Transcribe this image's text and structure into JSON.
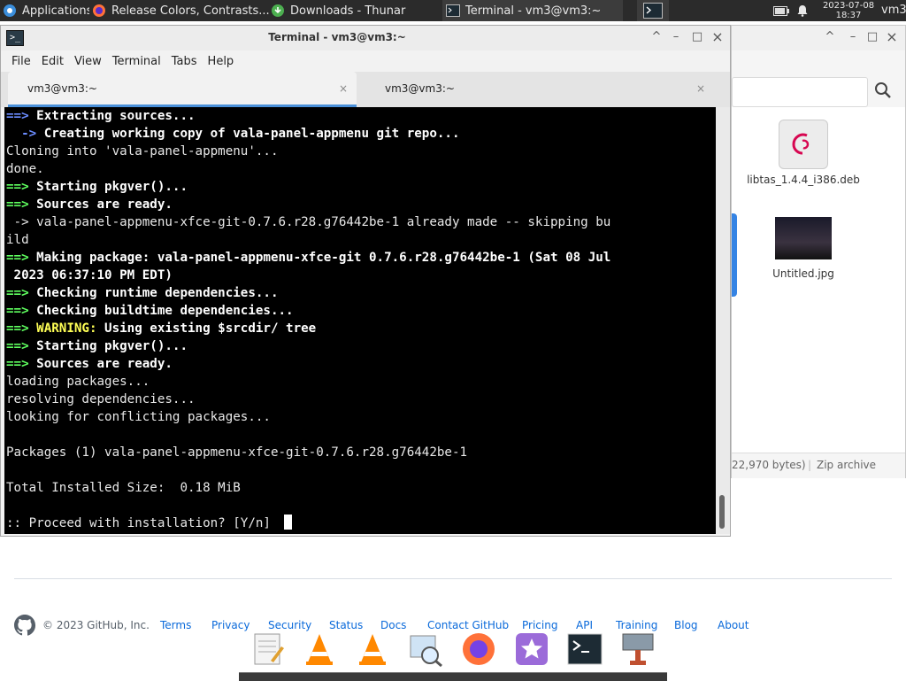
{
  "top_panel": {
    "applications_label": "Applications",
    "tasks": [
      {
        "label": "Release Colors, Contrasts..."
      },
      {
        "label": "Downloads - Thunar"
      },
      {
        "label": "Terminal - vm3@vm3:~"
      }
    ],
    "clock_date": "2023-07-08",
    "clock_time": "18:37",
    "user": "vm3"
  },
  "terminal": {
    "title": "Terminal - vm3@vm3:~",
    "menu": [
      "File",
      "Edit",
      "View",
      "Terminal",
      "Tabs",
      "Help"
    ],
    "tabs": [
      {
        "label": "vm3@vm3:~",
        "close": "×"
      },
      {
        "label": "vm3@vm3:~",
        "close": "×"
      }
    ],
    "window_buttons": {
      "up": "^",
      "minimize": "–",
      "maximize": "□",
      "close": "×"
    },
    "lines": [
      [
        {
          "t": "==> ",
          "c": "bl"
        },
        {
          "t": "Extracting sources...",
          "c": "w"
        }
      ],
      [
        {
          "t": "  -> ",
          "c": "bl"
        },
        {
          "t": "Creating working copy of vala-panel-appmenu git repo...",
          "c": "w"
        }
      ],
      [
        {
          "t": "Cloning into 'vala-panel-appmenu'...",
          "c": ""
        }
      ],
      [
        {
          "t": "done.",
          "c": ""
        }
      ],
      [
        {
          "t": "==> ",
          "c": "g"
        },
        {
          "t": "Starting pkgver()...",
          "c": "w"
        }
      ],
      [
        {
          "t": "==> ",
          "c": "g"
        },
        {
          "t": "Sources are ready.",
          "c": "w"
        }
      ],
      [
        {
          "t": " -> vala-panel-appmenu-xfce-git-0.7.6.r28.g76442be-1 already made -- skipping bu",
          "c": ""
        }
      ],
      [
        {
          "t": "ild",
          "c": ""
        }
      ],
      [
        {
          "t": "==> ",
          "c": "g"
        },
        {
          "t": "Making package: vala-panel-appmenu-xfce-git 0.7.6.r28.g76442be-1 (Sat 08 Jul",
          "c": "w"
        }
      ],
      [
        {
          "t": " 2023 06:37:10 PM EDT)",
          "c": "w"
        }
      ],
      [
        {
          "t": "==> ",
          "c": "g"
        },
        {
          "t": "Checking runtime dependencies...",
          "c": "w"
        }
      ],
      [
        {
          "t": "==> ",
          "c": "g"
        },
        {
          "t": "Checking buildtime dependencies...",
          "c": "w"
        }
      ],
      [
        {
          "t": "==> ",
          "c": "g"
        },
        {
          "t": "WARNING:",
          "c": "y"
        },
        {
          "t": " Using existing $srcdir/ tree",
          "c": "w"
        }
      ],
      [
        {
          "t": "==> ",
          "c": "g"
        },
        {
          "t": "Starting pkgver()...",
          "c": "w"
        }
      ],
      [
        {
          "t": "==> ",
          "c": "g"
        },
        {
          "t": "Sources are ready.",
          "c": "w"
        }
      ],
      [
        {
          "t": "loading packages...",
          "c": ""
        }
      ],
      [
        {
          "t": "resolving dependencies...",
          "c": ""
        }
      ],
      [
        {
          "t": "looking for conflicting packages...",
          "c": ""
        }
      ],
      [
        {
          "t": "",
          "c": ""
        }
      ],
      [
        {
          "t": "Packages (1) vala-panel-appmenu-xfce-git-0.7.6.r28.g76442be-1",
          "c": ""
        }
      ],
      [
        {
          "t": "",
          "c": ""
        }
      ],
      [
        {
          "t": "Total Installed Size:  0.18 MiB",
          "c": ""
        }
      ],
      [
        {
          "t": "",
          "c": ""
        }
      ],
      [
        {
          "t": ":: Proceed with installation? [Y/n] ",
          "c": ""
        }
      ]
    ]
  },
  "thunar": {
    "files": [
      {
        "name": "libtas_1.4.4_i386.deb"
      },
      {
        "name": "Untitled.jpg"
      }
    ],
    "status_size": "22,970 bytes)",
    "status_sep": "|",
    "status_type": "Zip archive"
  },
  "footer": {
    "copyright": "© 2023 GitHub, Inc.",
    "links": [
      "Terms",
      "Privacy",
      "Security",
      "Status",
      "Docs",
      "Contact GitHub",
      "Pricing",
      "API",
      "Training",
      "Blog",
      "About"
    ]
  },
  "dock": {
    "items": [
      "text-editor-icon",
      "vlc-icon",
      "vlc-icon",
      "image-viewer-icon",
      "firefox-icon",
      "bookmarks-icon",
      "terminal-icon",
      "network-icon"
    ]
  },
  "colors": {
    "panel": "#2b2b2b",
    "terminal_bg": "#000000",
    "prompt_green": "#5fff5f",
    "prompt_blue": "#6b8cff",
    "warning_yellow": "#ffff55",
    "link_blue": "#0969da"
  }
}
